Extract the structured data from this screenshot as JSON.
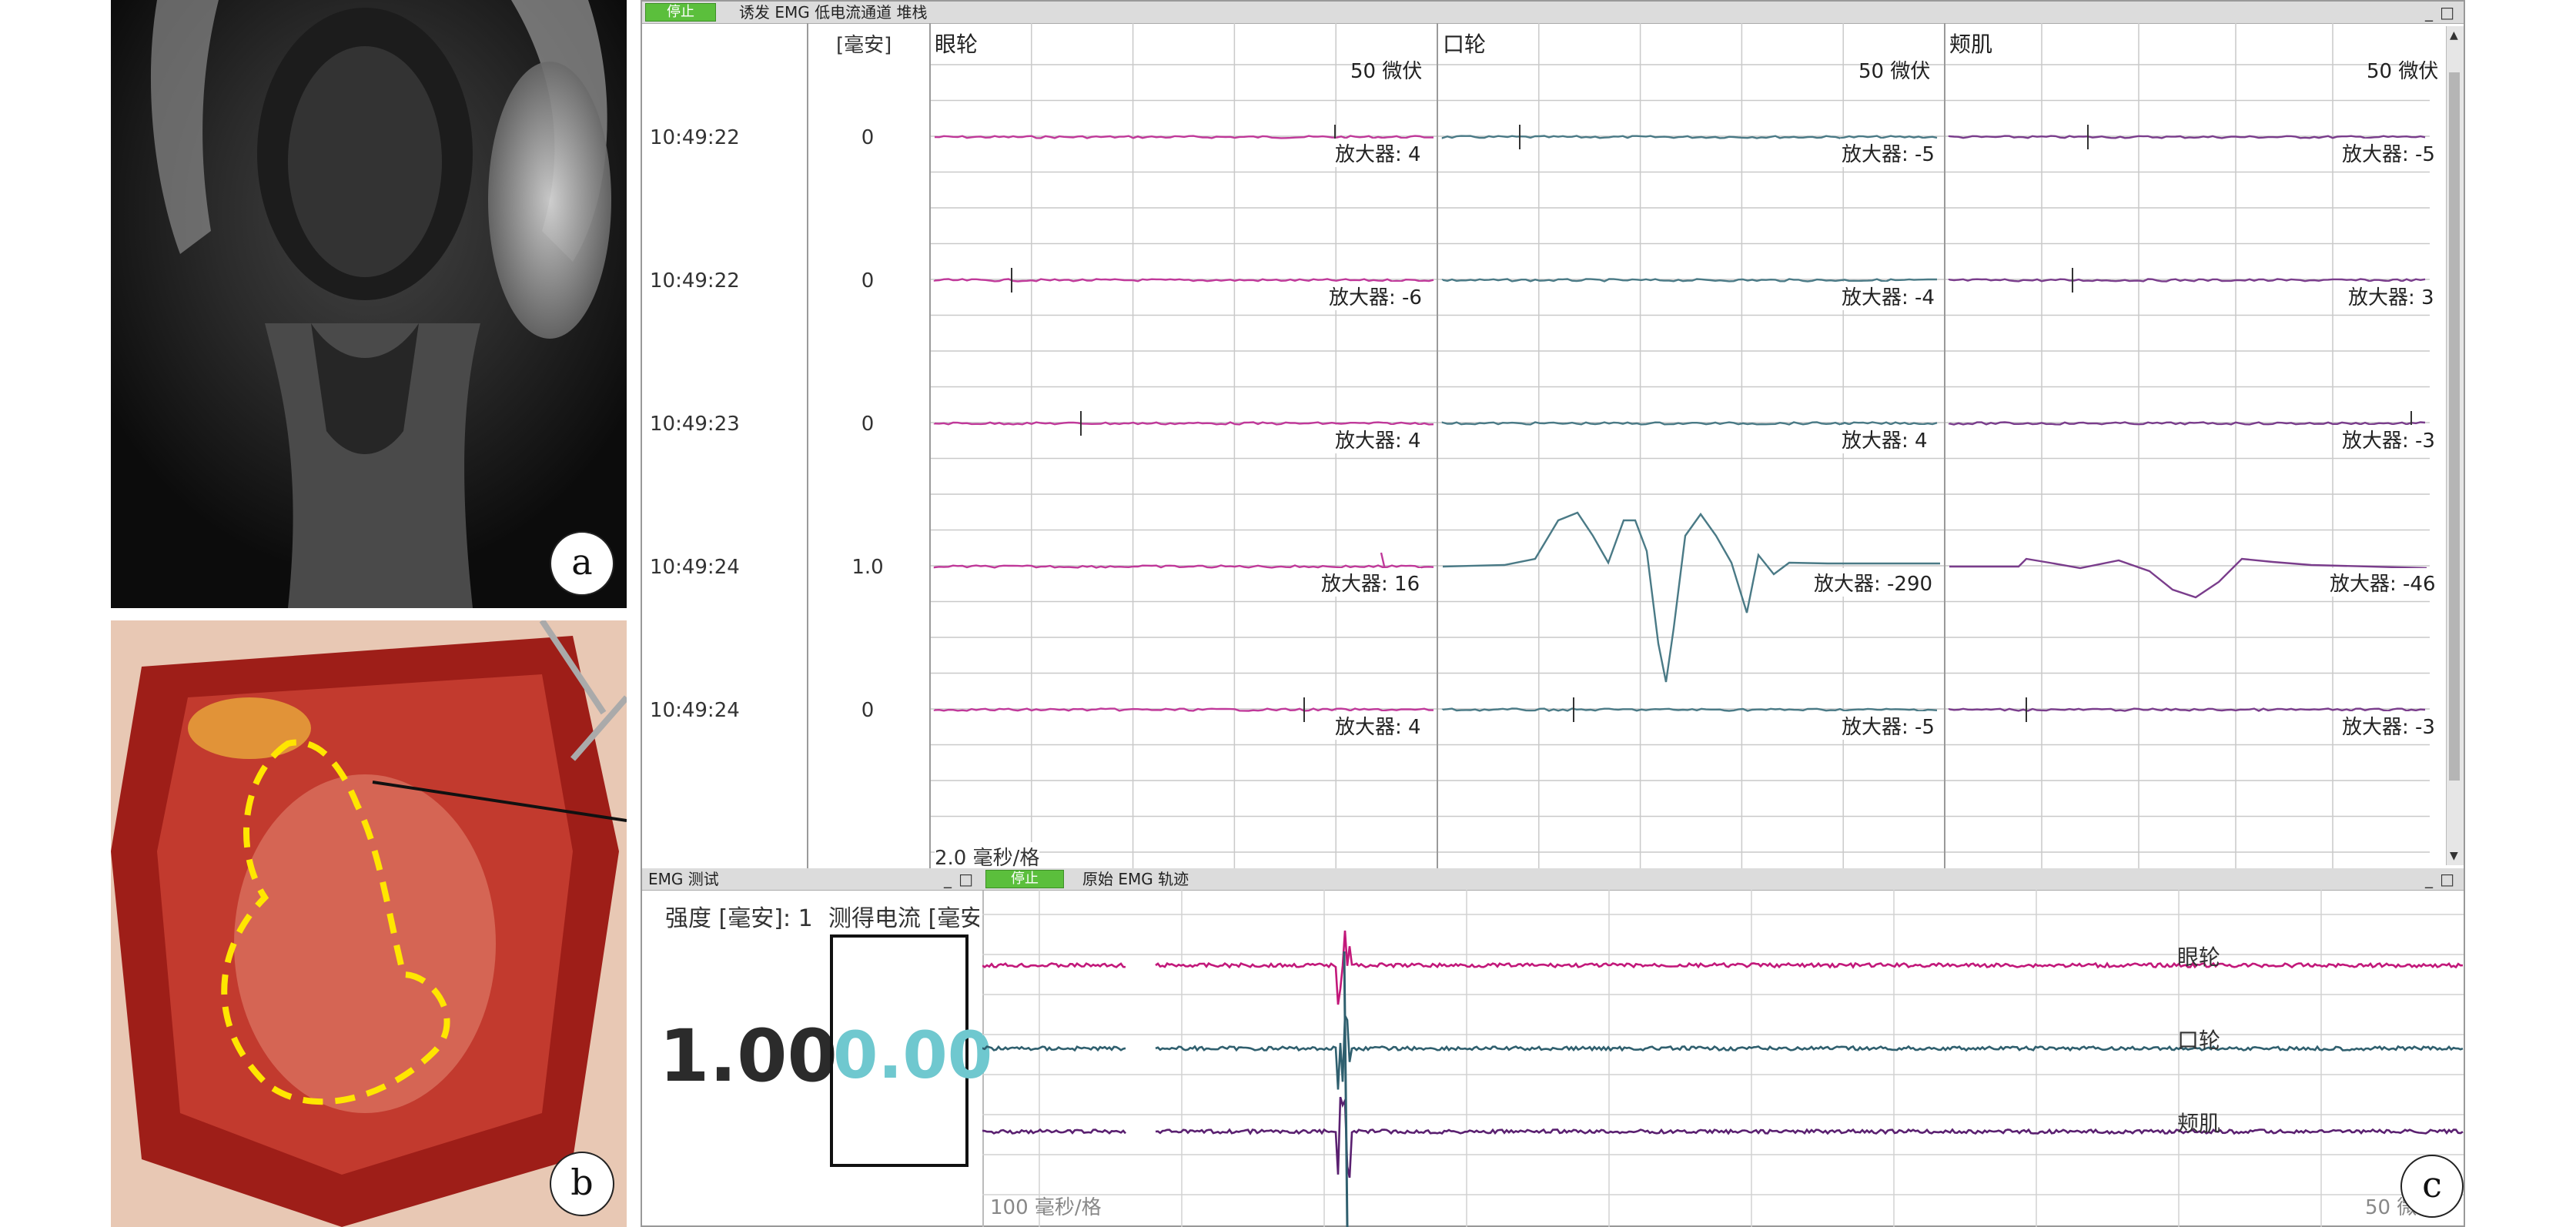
{
  "panels": {
    "a": {
      "label": "a"
    },
    "b": {
      "label": "b"
    },
    "c": {
      "label": "c"
    }
  },
  "top_window": {
    "stop_button": "停止",
    "title": "诱发 EMG 低电流通道 堆栈",
    "ma_header": "[毫安]",
    "time_per_div": "2.0 毫秒/格",
    "channels": [
      {
        "name": "眼轮",
        "scale": "50 微伏",
        "color": "#c0399a"
      },
      {
        "name": "口轮",
        "scale": "50 微伏",
        "color": "#4a7a86"
      },
      {
        "name": "颊肌",
        "scale": "50 微伏",
        "color": "#7a3d8c"
      }
    ],
    "rows": [
      {
        "time": "10:49:22",
        "ma": "0",
        "amps": [
          "放大器: 4",
          "放大器: -5",
          "放大器: -5"
        ]
      },
      {
        "time": "10:49:22",
        "ma": "0",
        "amps": [
          "放大器: -6",
          "放大器: -4",
          "放大器: 3"
        ]
      },
      {
        "time": "10:49:23",
        "ma": "0",
        "amps": [
          "放大器: 4",
          "放大器: 4",
          "放大器: -3"
        ]
      },
      {
        "time": "10:49:24",
        "ma": "1.0",
        "amps": [
          "放大器: 16",
          "放大器: -290",
          "放大器: -46"
        ]
      },
      {
        "time": "10:49:24",
        "ma": "0",
        "amps": [
          "放大器: 4",
          "放大器: -5",
          "放大器: -3"
        ]
      }
    ]
  },
  "emg_test": {
    "title": "EMG 测试",
    "intensity_label": "强度 [毫安]: 1",
    "measured_label": "测得电流 [毫安",
    "intensity_value": "1.00",
    "measured_value": "0.00"
  },
  "raw_emg": {
    "stop_button": "停止",
    "title": "原始 EMG 轨迹",
    "time_per_div": "100 毫秒/格",
    "scale_partial": "50 微伏",
    "traces": [
      {
        "name": "眼轮",
        "color": "#c2187a"
      },
      {
        "name": "口轮",
        "color": "#2f5f6e"
      },
      {
        "name": "颊肌",
        "color": "#5a2070"
      }
    ]
  },
  "window_controls": {
    "minimize": "_",
    "maximize": "□"
  }
}
